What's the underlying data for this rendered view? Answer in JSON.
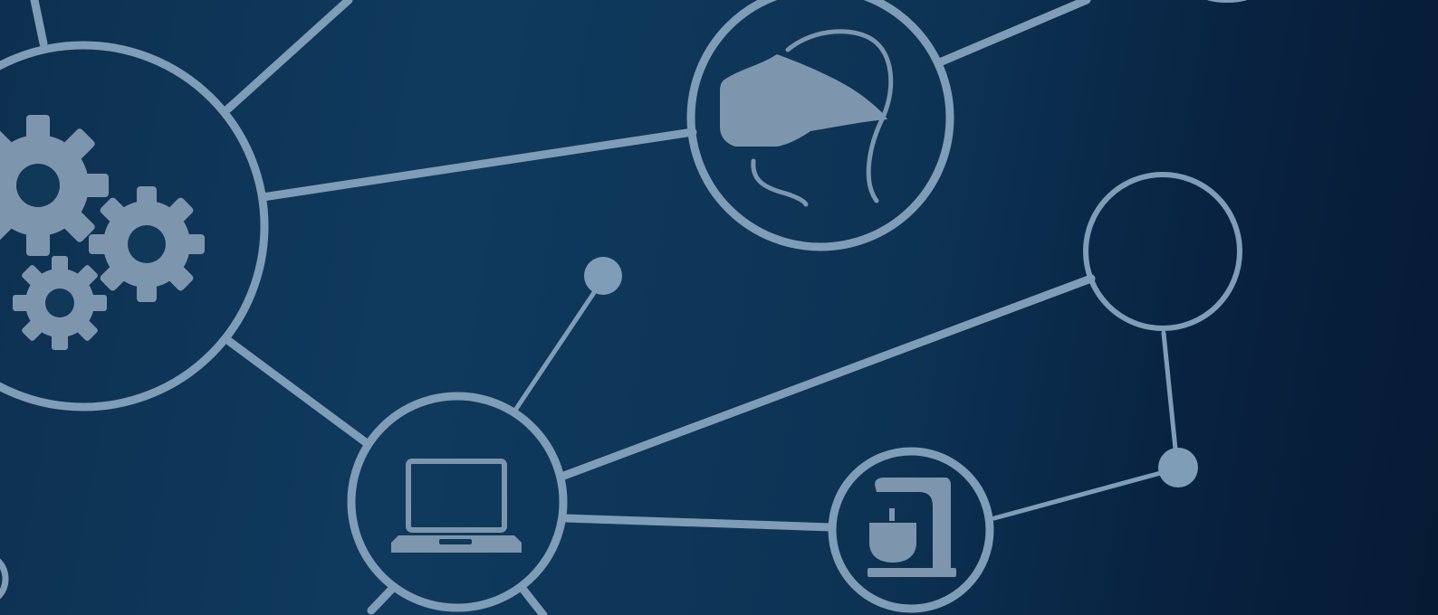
{
  "background": {
    "colors": [
      "#0f3a5e",
      "#0d3354",
      "#061a33"
    ],
    "line_color": "#7f9db6",
    "icon_color": "#7d96ad"
  },
  "network": {
    "icons": [
      "gears-icon",
      "vr-headset-icon",
      "laptop-icon",
      "stand-mixer-icon"
    ],
    "empty_nodes": 2,
    "dot_nodes": 2
  }
}
